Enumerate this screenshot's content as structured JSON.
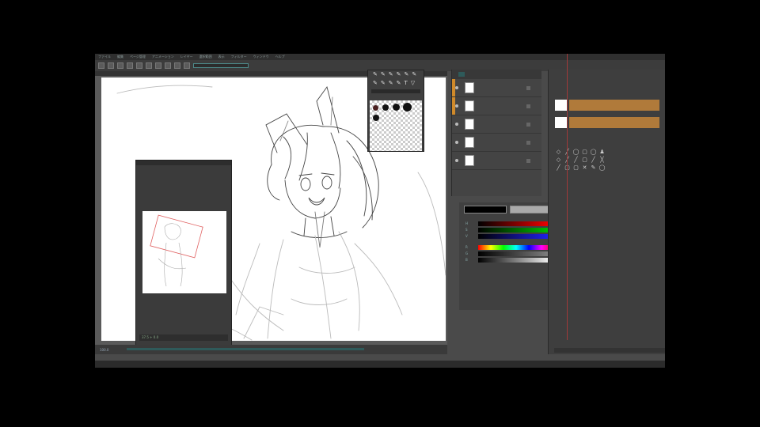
{
  "app": {
    "menu": [
      "ファイル",
      "編集",
      "ページ管理",
      "アニメーション",
      "レイヤー",
      "選択範囲",
      "表示",
      "フィルター",
      "ウィンドウ",
      "ヘルプ"
    ],
    "toolbar_field": "",
    "status_items": [
      "100.0",
      "",
      "",
      "",
      ""
    ]
  },
  "canvas": {
    "navigator_status": "37.5 + 0.0"
  },
  "brush_panel": {
    "tools_row1": [
      "✎",
      "✎",
      "✎",
      "✎",
      "✎",
      "✎"
    ],
    "tools_row2": [
      "✎",
      "✎",
      "✎",
      "✎",
      "T",
      "▽"
    ],
    "tab_label": ""
  },
  "layers": {
    "tab_label": "",
    "rows": [
      {
        "name": "",
        "accent": true
      },
      {
        "name": "",
        "accent": true
      },
      {
        "name": "",
        "accent": false
      },
      {
        "name": "",
        "accent": false
      },
      {
        "name": "",
        "accent": false
      }
    ]
  },
  "color_panel": {
    "foreground": "#000000",
    "background": "#aaaaaa",
    "slider_labels": [
      "H",
      "S",
      "V",
      "R",
      "G",
      "B"
    ]
  },
  "swatches": {
    "accent_color": "#b07a3a",
    "tool_icons": [
      "◇",
      "╱",
      "◯",
      "▢",
      "◯",
      "♟",
      "◇",
      "╱",
      "╱",
      "▢",
      "╱",
      "╳",
      "╱",
      "▢",
      "▢",
      "✕",
      "✎",
      "◯"
    ]
  },
  "colors": {
    "teal_accent": "#4d8a8a",
    "orange_accent": "#d08a2a",
    "guide_red": "#a03a3a"
  }
}
